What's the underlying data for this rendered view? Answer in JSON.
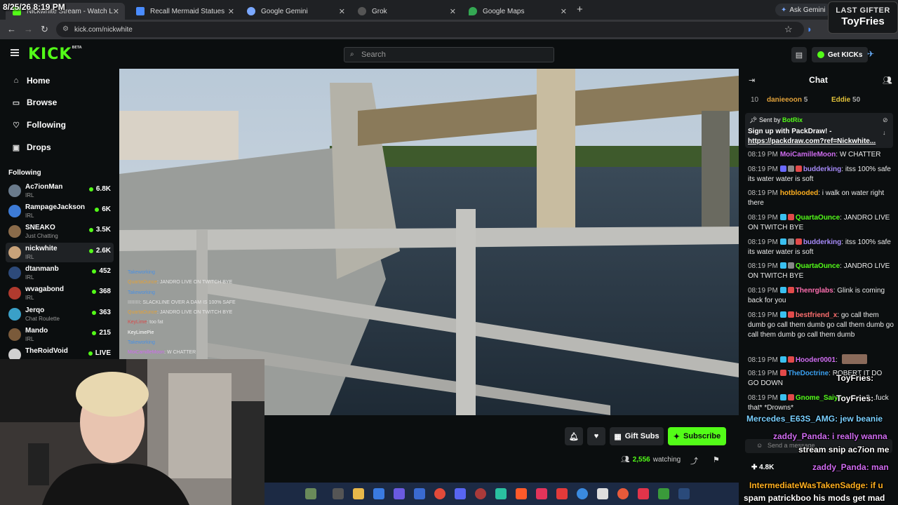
{
  "browser": {
    "tabs": [
      {
        "title": "Nickwhite Stream - Watch L",
        "color": "#53fc18",
        "active": true
      },
      {
        "title": "Recall Mermaid Statues",
        "color": "#4a8cff",
        "active": false
      },
      {
        "title": "Google Gemini",
        "color": "#7aa8ff",
        "active": false
      },
      {
        "title": "Grok",
        "color": "#cccccc",
        "active": false
      },
      {
        "title": "Google Maps",
        "color": "#34a853",
        "active": false
      }
    ],
    "ask_gemini": "Ask Gemini",
    "url": "kick.com/nickwhite"
  },
  "overlay": {
    "datetime": "8/25/26 8:19 PM",
    "last_gifter_label": "LAST GIFTER",
    "last_gifter_name": "ToyFries"
  },
  "header": {
    "logo": "KICK",
    "logo_beta": "BETA",
    "search_placeholder": "Search",
    "get_kicks": "Get KICKs"
  },
  "sidebar": {
    "nav": [
      {
        "label": "Home",
        "icon": "home-icon"
      },
      {
        "label": "Browse",
        "icon": "browse-icon"
      },
      {
        "label": "Following",
        "icon": "heart-icon"
      },
      {
        "label": "Drops",
        "icon": "drops-icon"
      }
    ],
    "following_header": "Following",
    "following": [
      {
        "name": "Ac7ionMan",
        "category": "IRL",
        "viewers": "6.8K",
        "color": "#6a7b8c"
      },
      {
        "name": "RampageJackson",
        "category": "IRL",
        "viewers": "6K",
        "color": "#3d7bd6"
      },
      {
        "name": "SNEAKO",
        "category": "Just Chatting",
        "viewers": "3.5K",
        "color": "#8a6b4a"
      },
      {
        "name": "nickwhite",
        "category": "IRL",
        "viewers": "2.6K",
        "color": "#c9a37a"
      },
      {
        "name": "dtanmanb",
        "category": "IRL",
        "viewers": "452",
        "color": "#2d4a7a"
      },
      {
        "name": "wvagabond",
        "category": "IRL",
        "viewers": "368",
        "color": "#b03a2e"
      },
      {
        "name": "Jerqo",
        "category": "Chat Roulette",
        "viewers": "363",
        "color": "#3aa0c8"
      },
      {
        "name": "Mando",
        "category": "IRL",
        "viewers": "215",
        "color": "#7a5a3a"
      },
      {
        "name": "TheRoidVoid",
        "category": "",
        "viewers": "LIVE",
        "color": "#d0d0d0"
      }
    ]
  },
  "video_chat_overlay": [
    {
      "user": "Takeworking",
      "text": "",
      "color": "#4a90e2"
    },
    {
      "user": "QuartaOunce",
      "text": ": JANDRO LIVE ON TWITCH BYE",
      "color": "#e2a23a"
    },
    {
      "user": "Takeworking",
      "text": "",
      "color": "#4a90e2"
    },
    {
      "user": "IIIIIIIII",
      "text": ": SLACKLINE OVER A DAM IS 100% SAFE",
      "color": "#cccccc"
    },
    {
      "user": "QuartaOunce",
      "text": ": JANDRO LIVE ON TWITCH BYE",
      "color": "#e2a23a"
    },
    {
      "user": "KeyLime",
      "text": ": too fat",
      "color": "#d94a4a"
    },
    {
      "user": "KeyLimePie",
      "text": "",
      "color": "#ffffff"
    },
    {
      "user": "Takeworking",
      "text": "",
      "color": "#4a90e2"
    },
    {
      "user": "MoiCamilleMoon",
      "text": ": W CHATTER",
      "color": "#cf6cf0"
    }
  ],
  "actions": {
    "gift_subs": "Gift Subs",
    "subscribe": "Subscribe",
    "watching_count": "2,556",
    "watching_label": "watching"
  },
  "chat": {
    "title": "Chat",
    "top_gifters": [
      {
        "rank": "10",
        "name": "danieeoon",
        "count": "5",
        "color": "#e2a23a"
      },
      {
        "rank": "",
        "name": "Eddie",
        "count": "50",
        "color": "#e2c23a"
      }
    ],
    "pinned": {
      "sent_by_label": "Sent by",
      "sender": "BotRix",
      "line1": "Sign up with PackDraw! -",
      "link": "https://packdraw.com?ref=Nickwhite..."
    },
    "messages": [
      {
        "time": "08:19 PM",
        "user": "MoiCamilleMoon",
        "color": "#cf6cf0",
        "text": ": W CHATTER"
      },
      {
        "time": "08:19 PM",
        "user": "budderking",
        "color": "#a78bfa",
        "text": ": itss 100% safe its water water is soft"
      },
      {
        "time": "08:19 PM",
        "user": "hotblooded",
        "color": "#ffb020",
        "text": ": i walk on water right there"
      },
      {
        "time": "08:19 PM",
        "user": "QuartaOunce",
        "color": "#53fc18",
        "text": ": JANDRO LIVE ON TWITCH BYE"
      },
      {
        "time": "08:19 PM",
        "user": "budderking",
        "color": "#a78bfa",
        "text": ": itss 100% safe its water water is soft"
      },
      {
        "time": "08:19 PM",
        "user": "QuartaOunce",
        "color": "#53fc18",
        "text": ": JANDRO LIVE ON TWITCH BYE"
      },
      {
        "time": "08:19 PM",
        "user": "Thenrglabs",
        "color": "#ff6fb0",
        "text": ": Glink is coming back for you"
      },
      {
        "time": "08:19 PM",
        "user": "bestfriend_x",
        "color": "#ff6f6f",
        "text": ": go call them dumb go call them dumb go call them dumb go call them dumb go call them dumb"
      },
      {
        "time": "08:19 PM",
        "user": "Hooder0001",
        "color": "#cf6cf0",
        "text": ":"
      },
      {
        "time": "08:19 PM",
        "user": "TheDoctrine",
        "color": "#3aa0f0",
        "text": ": ROBERT IT DO GO DOWN"
      },
      {
        "time": "08:19 PM",
        "user": "Gnome_Saiyan",
        "color": "#53fc18",
        "text": ": swim?...fuck that* *Drowns*"
      }
    ],
    "send_placeholder": "Send a message",
    "kicks_count": "4.8K"
  },
  "stream_overlay_chat": [
    {
      "text": "ToyFries:",
      "color": "#ffffff"
    },
    {
      "text": "ToyFries:",
      "color": "#ffffff"
    },
    {
      "text": "Mercedes_E63S_AMG: jew beanie",
      "color": "#7ad0ff"
    },
    {
      "text": "zaddy_Panda: i really wanna",
      "color": "#cf6cf0"
    },
    {
      "text": "stream snip ac7ion me",
      "color": "#ffffff"
    },
    {
      "text": "zaddy_Panda: man",
      "color": "#cf6cf0"
    },
    {
      "text": "IntermediateWasTakenSadge: if u",
      "color": "#ffb020"
    },
    {
      "text": "spam patrickboo his mods get mad",
      "color": "#ffffff"
    }
  ],
  "colors": {
    "accent": "#53fc18",
    "background": "#0b0e0f"
  }
}
